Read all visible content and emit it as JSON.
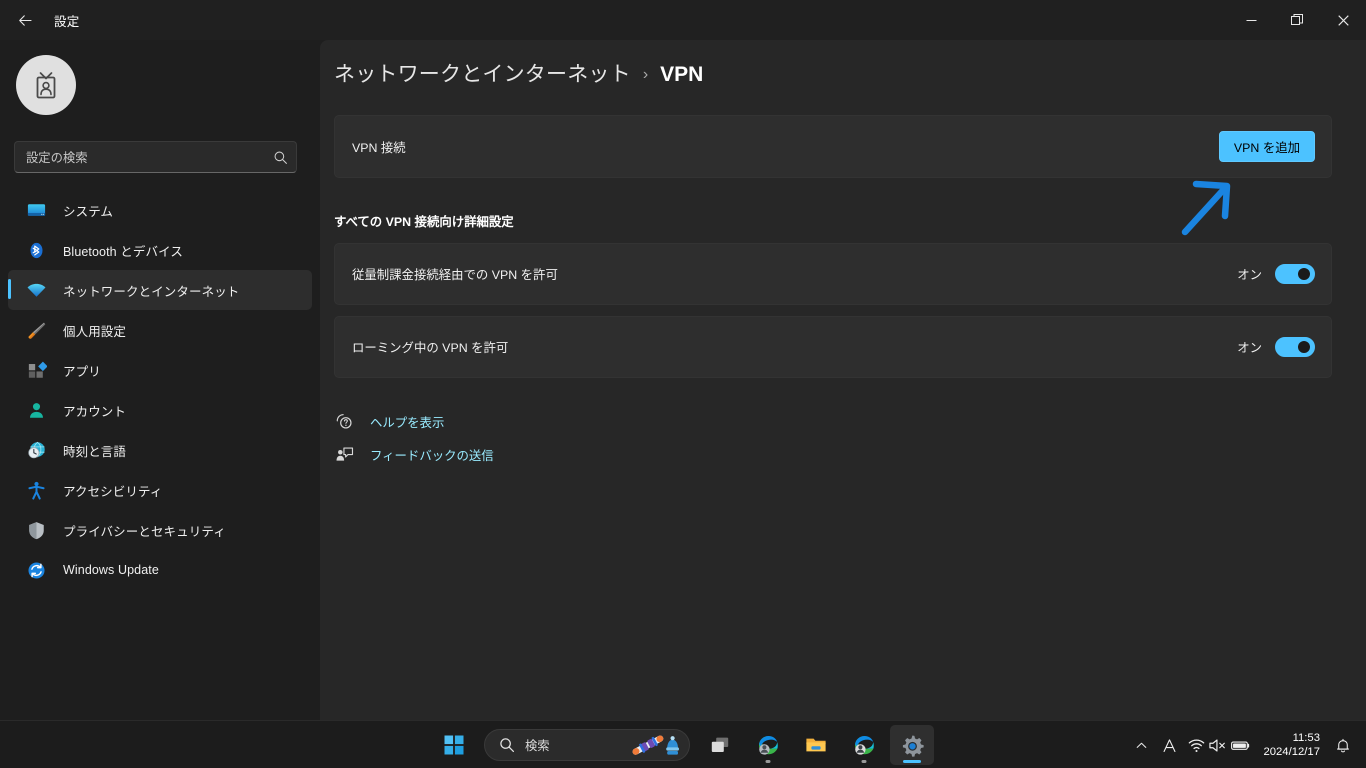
{
  "window": {
    "title": "設定",
    "back_icon": "back-arrow-icon",
    "minimize_label": "—",
    "maximize_label": "□",
    "close_label": "✕"
  },
  "sidebar": {
    "avatar_icon": "id-badge-icon",
    "search": {
      "placeholder": "設定の検索",
      "icon": "search-icon"
    },
    "items": [
      {
        "label": "システム",
        "icon": "system-icon",
        "active": false
      },
      {
        "label": "Bluetooth とデバイス",
        "icon": "bluetooth-icon",
        "active": false
      },
      {
        "label": "ネットワークとインターネット",
        "icon": "wifi-icon",
        "active": true
      },
      {
        "label": "個人用設定",
        "icon": "paintbrush-icon",
        "active": false
      },
      {
        "label": "アプリ",
        "icon": "apps-icon",
        "active": false
      },
      {
        "label": "アカウント",
        "icon": "account-icon",
        "active": false
      },
      {
        "label": "時刻と言語",
        "icon": "clock-globe-icon",
        "active": false
      },
      {
        "label": "アクセシビリティ",
        "icon": "accessibility-icon",
        "active": false
      },
      {
        "label": "プライバシーとセキュリティ",
        "icon": "shield-icon",
        "active": false
      },
      {
        "label": "Windows Update",
        "icon": "update-icon",
        "active": false
      }
    ]
  },
  "main": {
    "breadcrumb": {
      "parent": "ネットワークとインターネット",
      "separator": "›",
      "current": "VPN"
    },
    "vpn_connection": {
      "label": "VPN 接続",
      "add_button": "VPN を追加"
    },
    "section_title": "すべての VPN 接続向け詳細設定",
    "settings": [
      {
        "label": "従量制課金接続経由での VPN を許可",
        "state": "オン",
        "on": true
      },
      {
        "label": "ローミング中の VPN を許可",
        "state": "オン",
        "on": true
      }
    ],
    "links": [
      {
        "label": "ヘルプを表示",
        "icon": "help-icon"
      },
      {
        "label": "フィードバックの送信",
        "icon": "feedback-icon"
      }
    ],
    "annotation": {
      "type": "arrow",
      "color": "#1a84e0",
      "points_to": "VPN を追加"
    }
  },
  "taskbar": {
    "start_label": "start-icon",
    "search": {
      "placeholder": "検索",
      "icon": "search-icon",
      "decoration": "winter-sports-illustration"
    },
    "buttons": [
      {
        "name": "task-view",
        "open": false,
        "active": false
      },
      {
        "name": "edge-browser",
        "open": true,
        "active": false
      },
      {
        "name": "file-explorer",
        "open": false,
        "active": false
      },
      {
        "name": "edge-browser-2",
        "open": true,
        "active": false
      },
      {
        "name": "settings-app",
        "open": true,
        "active": true
      }
    ],
    "tray": {
      "chevron": "chevron-up-icon",
      "ime": "A",
      "wifi": "wifi-icon",
      "volume": "volume-muted-icon",
      "battery": "battery-icon",
      "time": "11:53",
      "date": "2024/12/17",
      "notification": "bell-icon"
    }
  },
  "colors": {
    "accent": "#4cc2ff",
    "page_bg": "#272727",
    "sidebar_bg": "#1e1e1e",
    "card_bg": "#2e2e2e",
    "link": "#99ebff",
    "annotation": "#1a84e0"
  }
}
